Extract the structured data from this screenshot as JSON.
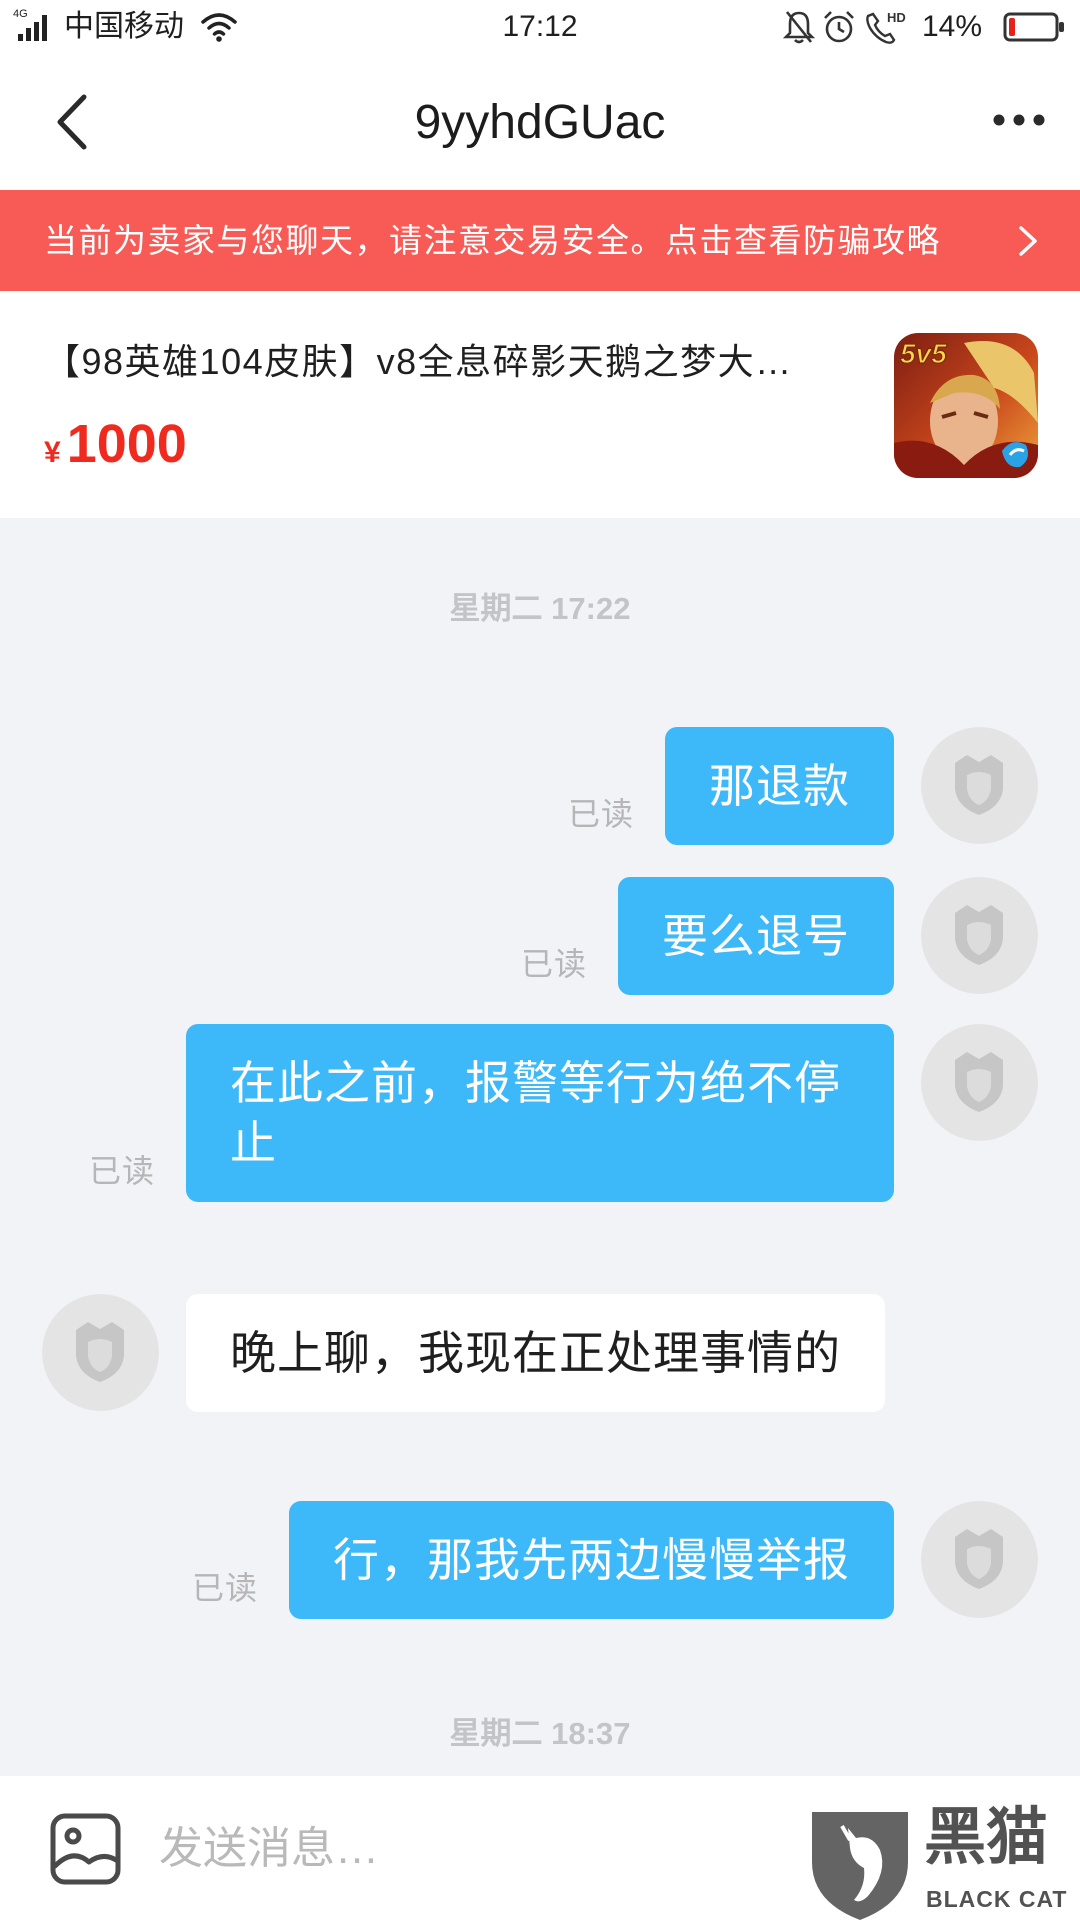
{
  "status_bar": {
    "network": "4G",
    "carrier": "中国移动",
    "time": "17:12",
    "call_badge": "HD",
    "battery_percent": "14%",
    "battery_level": 0.14,
    "icons": [
      "signal-icon",
      "wifi-icon",
      "bell-off-icon",
      "alarm-icon",
      "hd-call-icon",
      "battery-icon"
    ]
  },
  "header": {
    "title": "9yyhdGUac",
    "icons": {
      "back": "chevron-left-icon",
      "more": "more-dots-icon"
    }
  },
  "banner": {
    "text": "当前为卖家与您聊天，请注意交易安全。点击查看防骗攻略",
    "icon": "chevron-right-icon"
  },
  "product": {
    "title": "【98英雄104皮肤】v8全息碎影天鹅之梦大…",
    "currency": "¥",
    "price": "1000",
    "thumbnail_badge": "5v5"
  },
  "chat": {
    "timestamps": [
      "星期二 17:22",
      "星期二 18:37"
    ],
    "messages": [
      {
        "outgoing": true,
        "text": "那退款",
        "status": "已读"
      },
      {
        "outgoing": true,
        "text": "要么退号",
        "status": "已读"
      },
      {
        "outgoing": true,
        "text": "在此之前，报警等行为绝不停止",
        "status": "已读"
      },
      {
        "outgoing": false,
        "text": "晚上聊，我现在正处理事情的"
      },
      {
        "outgoing": true,
        "text": "行，那我先两边慢慢举报",
        "status": "已读"
      }
    ]
  },
  "input": {
    "placeholder": "发送消息…",
    "icon": "image-icon"
  },
  "watermark": {
    "cn": "黑猫",
    "en": "BLACK CAT"
  },
  "colors": {
    "banner": "#f85b55",
    "bubble_sent": "#3db8f8",
    "price": "#ef2a1f",
    "chat_bg": "#f2f3f7"
  }
}
